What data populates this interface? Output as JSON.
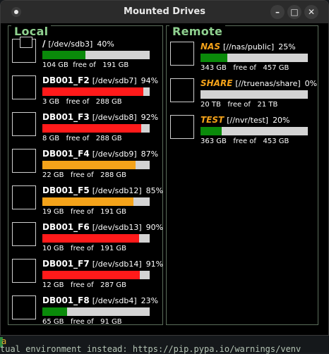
{
  "window": {
    "title": "Mounted Drives"
  },
  "colors": {
    "green": "#0a8a0a",
    "orange": "#f4a31a",
    "red": "#ff1a1a",
    "track": "#d3d3d3",
    "panel_title": "#8fd18f",
    "remote_name": "#f5a31a"
  },
  "local": {
    "title": "Local",
    "drives": [
      {
        "name": "/",
        "path": "[/dev/sdb3]",
        "percent": "40%",
        "usage": 0.4,
        "color": "green",
        "info": "104 GB  free of   191 GB",
        "icon": "root-drive-icon"
      },
      {
        "name": "DB001_F2",
        "path": "[/dev/sdb7]",
        "percent": "94%",
        "usage": 0.94,
        "color": "red",
        "info": "3 GB   free of   288 GB",
        "icon": "drive-icon"
      },
      {
        "name": "DB001_F3",
        "path": "[/dev/sdb8]",
        "percent": "92%",
        "usage": 0.92,
        "color": "red",
        "info": "8 GB   free of   288 GB",
        "icon": "drive-icon"
      },
      {
        "name": "DB001_F4",
        "path": "[/dev/sdb9]",
        "percent": "87%",
        "usage": 0.87,
        "color": "orange",
        "info": "22 GB   free of   288 GB",
        "icon": "drive-icon"
      },
      {
        "name": "DB001_F5",
        "path": "[/dev/sdb12]",
        "percent": "85%",
        "usage": 0.85,
        "color": "orange",
        "info": "19 GB   free of   191 GB",
        "icon": "drive-icon"
      },
      {
        "name": "DB001_F6",
        "path": "[/dev/sdb13]",
        "percent": "90%",
        "usage": 0.9,
        "color": "red",
        "info": "10 GB   free of   191 GB",
        "icon": "drive-icon"
      },
      {
        "name": "DB001_F7",
        "path": "[/dev/sdb14]",
        "percent": "91%",
        "usage": 0.91,
        "color": "red",
        "info": "12 GB   free of   287 GB",
        "icon": "drive-icon"
      },
      {
        "name": "DB001_F8",
        "path": "[/dev/sdb4]",
        "percent": "23%",
        "usage": 0.23,
        "color": "green",
        "info": "65 GB   free of   91 GB",
        "icon": "drive-icon"
      }
    ]
  },
  "remote": {
    "title": "Remote",
    "drives": [
      {
        "name": "NAS",
        "path": "[//nas/public]",
        "percent": "25%",
        "usage": 0.25,
        "color": "green",
        "info": "343 GB   free of   457 GB",
        "icon": "network-drive-icon"
      },
      {
        "name": "SHARE",
        "path": "[//truenas/share]",
        "percent": "0%",
        "usage": 0.0,
        "color": "green",
        "info": "20 TB   free of   21 TB",
        "icon": "network-drive-icon"
      },
      {
        "name": "TEST",
        "path": "[//nvr/test]",
        "percent": "20%",
        "usage": 0.2,
        "color": "green",
        "info": "363 GB   free of   453 GB",
        "icon": "network-drive-icon"
      }
    ]
  },
  "background_terminal": {
    "lines": [
      "a",
      "tual environment instead: https://pip.pypa.io/warnings/venv"
    ]
  }
}
